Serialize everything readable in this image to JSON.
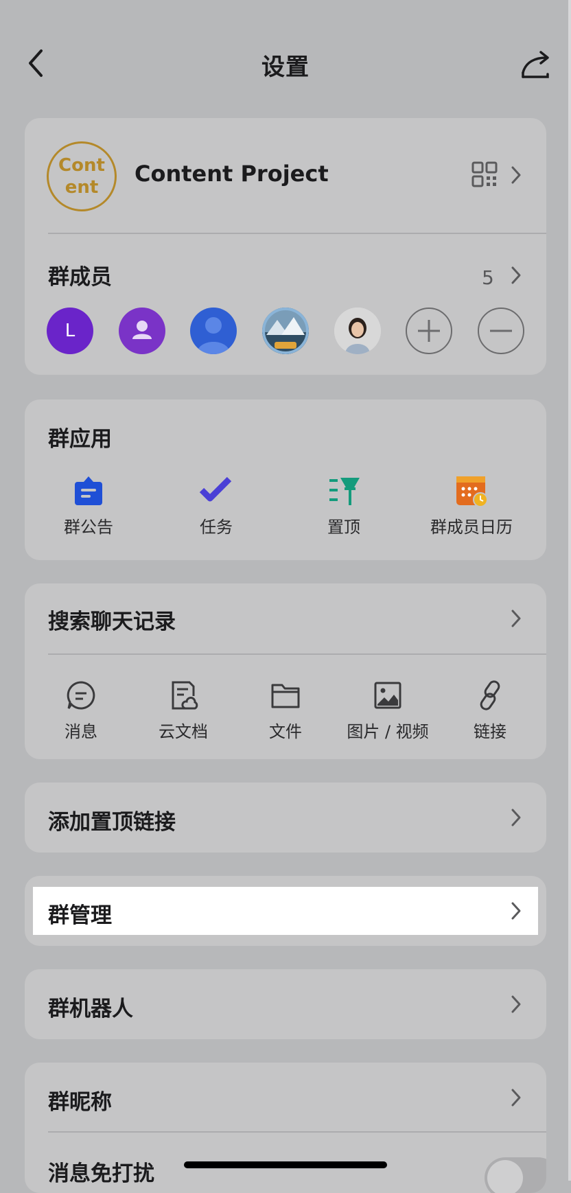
{
  "header": {
    "title": "设置",
    "back_icon": "chevron-left-icon",
    "share_icon": "share-icon"
  },
  "group": {
    "logo_text": "Content",
    "name": "Content Project",
    "qr_icon": "qr-code-icon"
  },
  "members": {
    "label": "群成员",
    "count": "5",
    "avatars": [
      {
        "type": "letter",
        "text": "L",
        "color": "#6a24c9"
      },
      {
        "type": "person-icon",
        "color": "#7a33c7"
      },
      {
        "type": "person-silhouette",
        "color": "#2f5fd3"
      },
      {
        "type": "photo-landscape"
      },
      {
        "type": "photo-portrait"
      }
    ],
    "add_icon": "plus-circle-icon",
    "remove_icon": "minus-circle-icon"
  },
  "apps": {
    "label": "群应用",
    "items": [
      {
        "label": "群公告",
        "icon": "announcement-icon",
        "color": "#1f4fd6"
      },
      {
        "label": "任务",
        "icon": "task-check-icon",
        "color": "#4a3fd6"
      },
      {
        "label": "置顶",
        "icon": "pin-icon",
        "color": "#149b7c"
      },
      {
        "label": "群成员日历",
        "icon": "calendar-icon",
        "color": "#e36c1e"
      }
    ]
  },
  "search": {
    "label": "搜索聊天记录",
    "tools": [
      {
        "label": "消息",
        "icon": "message-icon"
      },
      {
        "label": "云文档",
        "icon": "cloud-doc-icon"
      },
      {
        "label": "文件",
        "icon": "folder-icon"
      },
      {
        "label": "图片 / 视频",
        "icon": "image-icon"
      },
      {
        "label": "链接",
        "icon": "link-icon"
      }
    ]
  },
  "rows": {
    "pinned_link": "添加置顶链接",
    "group_manage": "群管理",
    "group_bot": "群机器人",
    "group_nickname": "群昵称",
    "mute": "消息免打扰"
  },
  "toggle": {
    "mute_on": false
  }
}
